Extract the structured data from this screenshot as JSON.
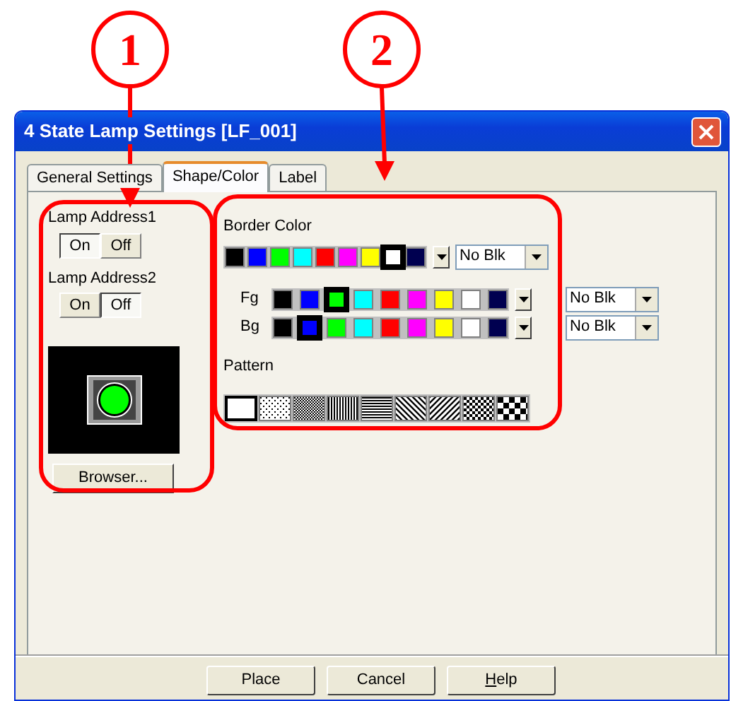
{
  "annotations": [
    {
      "label": "1"
    },
    {
      "label": "2"
    }
  ],
  "window": {
    "title": "4 State Lamp Settings [LF_001]"
  },
  "tabs": [
    {
      "label": "General Settings",
      "selected": false
    },
    {
      "label": "Shape/Color",
      "selected": true
    },
    {
      "label": "Label",
      "selected": false
    }
  ],
  "lamp_addresses": [
    {
      "label": "Lamp Address1",
      "buttons": [
        {
          "label": "On",
          "selected": true
        },
        {
          "label": "Off",
          "selected": false
        }
      ]
    },
    {
      "label": "Lamp Address2",
      "buttons": [
        {
          "label": "On",
          "selected": false
        },
        {
          "label": "Off",
          "selected": true
        }
      ]
    }
  ],
  "browser_button": "Browser...",
  "border_color": {
    "label": "Border Color",
    "swatches": [
      {
        "color": "#000000",
        "selected": false
      },
      {
        "color": "#0000ff",
        "selected": false
      },
      {
        "color": "#00ff00",
        "selected": false
      },
      {
        "color": "#00ffff",
        "selected": false
      },
      {
        "color": "#ff0000",
        "selected": false
      },
      {
        "color": "#ff00ff",
        "selected": false
      },
      {
        "color": "#ffff00",
        "selected": false
      },
      {
        "color": "#ffffff",
        "selected": true
      },
      {
        "color": "#000050",
        "selected": false
      }
    ],
    "dropdown": "No Blk"
  },
  "colors": [
    {
      "label": "Fg",
      "swatches": [
        {
          "color": "#000000",
          "selected": false
        },
        {
          "color": "#0000ff",
          "selected": false
        },
        {
          "color": "#00ff00",
          "selected": true
        },
        {
          "color": "#00ffff",
          "selected": false
        },
        {
          "color": "#ff0000",
          "selected": false
        },
        {
          "color": "#ff00ff",
          "selected": false
        },
        {
          "color": "#ffff00",
          "selected": false
        },
        {
          "color": "#ffffff",
          "selected": false
        },
        {
          "color": "#000050",
          "selected": false
        }
      ],
      "dropdown": "No Blk"
    },
    {
      "label": "Bg",
      "swatches": [
        {
          "color": "#000000",
          "selected": false
        },
        {
          "color": "#0000ff",
          "selected": true
        },
        {
          "color": "#00ff00",
          "selected": false
        },
        {
          "color": "#00ffff",
          "selected": false
        },
        {
          "color": "#ff0000",
          "selected": false
        },
        {
          "color": "#ff00ff",
          "selected": false
        },
        {
          "color": "#ffff00",
          "selected": false
        },
        {
          "color": "#ffffff",
          "selected": false
        },
        {
          "color": "#000050",
          "selected": false
        }
      ],
      "dropdown": "No Blk"
    }
  ],
  "pattern": {
    "label": "Pattern",
    "patterns": [
      {
        "kind": "solid",
        "selected": true
      },
      {
        "kind": "dots",
        "selected": false
      },
      {
        "kind": "fine",
        "selected": false
      },
      {
        "kind": "vertical",
        "selected": false
      },
      {
        "kind": "horizontal",
        "selected": false
      },
      {
        "kind": "diagdown",
        "selected": false
      },
      {
        "kind": "diagup",
        "selected": false
      },
      {
        "kind": "checker",
        "selected": false
      },
      {
        "kind": "bigchecker",
        "selected": false
      }
    ]
  },
  "buttons": [
    {
      "label": "Place"
    },
    {
      "label": "Cancel"
    },
    {
      "label": "Help",
      "first_letter_underlined": true
    }
  ]
}
